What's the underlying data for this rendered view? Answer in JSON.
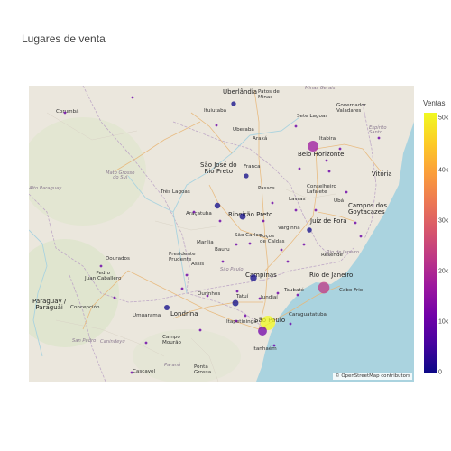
{
  "title": "Lugares de venta",
  "colorbar": {
    "title": "Ventas",
    "ticks": [
      "0",
      "10k",
      "20k",
      "30k",
      "40k",
      "50k"
    ],
    "colors": [
      "#0d0887",
      "#46039f",
      "#7201a8",
      "#9c179e",
      "#bd3786",
      "#d8576b",
      "#ed7953",
      "#fb9f3a",
      "#fdca26",
      "#f0f921"
    ]
  },
  "attribution": "© OpenStreetMap contributors",
  "places": [
    {
      "t": "Uberlândia",
      "c": "big"
    },
    {
      "t": "Patos de\nMinas"
    },
    {
      "t": "Minas Gerais",
      "c": "region"
    },
    {
      "t": "Corumbá"
    },
    {
      "t": "Ituiutaba"
    },
    {
      "t": "Sete Lagoas"
    },
    {
      "t": "Governador\nValadares"
    },
    {
      "t": "Uberaba"
    },
    {
      "t": "Araxá"
    },
    {
      "t": "Itabira"
    },
    {
      "t": "Espírito\nSanto",
      "c": "region"
    },
    {
      "t": "Belo Horizonte",
      "c": "big"
    },
    {
      "t": "Mato Grosso\ndo Sul",
      "c": "region"
    },
    {
      "t": "São José do\nRio Preto",
      "c": "big"
    },
    {
      "t": "Franca"
    },
    {
      "t": "Vitória",
      "c": "big"
    },
    {
      "t": "Alto Paraguay",
      "c": "region"
    },
    {
      "t": "Três Lagoas"
    },
    {
      "t": "Conselheiro\nLafaiete"
    },
    {
      "t": "Passos"
    },
    {
      "t": "Lavras"
    },
    {
      "t": "Ubá"
    },
    {
      "t": "Campos dos\nGoytacazes",
      "c": "big"
    },
    {
      "t": "Araçatuba"
    },
    {
      "t": "Ribeirão Preto",
      "c": "big"
    },
    {
      "t": "Juiz de Fora",
      "c": "big"
    },
    {
      "t": "São Carlos"
    },
    {
      "t": "Poços\nde Caldas"
    },
    {
      "t": "Varginha"
    },
    {
      "t": "Rio de Janeiro",
      "c": "region"
    },
    {
      "t": "Marília"
    },
    {
      "t": "Bauru"
    },
    {
      "t": "Presidente\nPrudente"
    },
    {
      "t": "Assis"
    },
    {
      "t": "Dourados"
    },
    {
      "t": "São Paulo",
      "c": "region"
    },
    {
      "t": "Resende"
    },
    {
      "t": "Rio de Janeiro",
      "c": "big"
    },
    {
      "t": "Campinas",
      "c": "big"
    },
    {
      "t": "Pedro\nJuan Caballero"
    },
    {
      "t": "Cabo Frio"
    },
    {
      "t": "Paraguay /\nParaguái",
      "c": "big"
    },
    {
      "t": "Ourinhos"
    },
    {
      "t": "Taubaté"
    },
    {
      "t": "Tatuí"
    },
    {
      "t": "Jundiaí"
    },
    {
      "t": "Concepción"
    },
    {
      "t": "Londrina",
      "c": "big"
    },
    {
      "t": "Itapetininga"
    },
    {
      "t": "São Paulo",
      "c": "big"
    },
    {
      "t": "Caraguatatuba"
    },
    {
      "t": "Umuarama"
    },
    {
      "t": "Campo\nMourão"
    },
    {
      "t": "San Pedro",
      "c": "region"
    },
    {
      "t": "Canindeyú",
      "c": "region"
    },
    {
      "t": "Itanhaém"
    },
    {
      "t": "Cascavel"
    },
    {
      "t": "Paraná",
      "c": "region"
    },
    {
      "t": "Ponta\nGrossa"
    }
  ],
  "points": [
    {
      "name": "Uberlândia",
      "ventas": 600
    },
    {
      "name": "Belo Horizonte",
      "ventas": 22000
    },
    {
      "name": "Rio de Janeiro",
      "ventas": 26000
    },
    {
      "name": "São Paulo",
      "ventas": 50000
    },
    {
      "name": "Campinas",
      "ventas": 4000
    },
    {
      "name": "Ribeirão Preto",
      "ventas": 3000
    },
    {
      "name": "São José do Rio Preto",
      "ventas": 2000
    },
    {
      "name": "Londrina",
      "ventas": 1500
    },
    {
      "name": "Santos",
      "ventas": 12000
    },
    {
      "name": "Sorocaba",
      "ventas": 3000
    },
    {
      "name": "Juiz de Fora",
      "ventas": 800
    },
    {
      "name": "Franca",
      "ventas": 500
    }
  ]
}
